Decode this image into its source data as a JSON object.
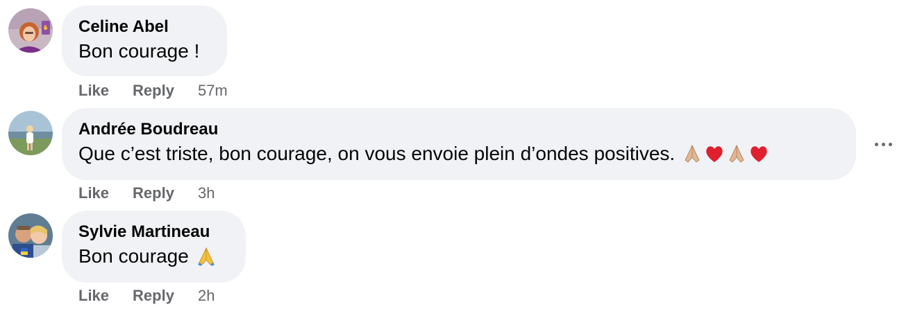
{
  "comments": [
    {
      "author": "Celine Abel",
      "text": "Bon courage !",
      "like_label": "Like",
      "reply_label": "Reply",
      "time": "57m",
      "avatar": "avatar-woman-red-hair"
    },
    {
      "author": "Andrée Boudreau",
      "text": "Que c’est triste, bon courage, on vous envoie plein d’ondes positives.",
      "emojis": [
        "folded-hands-icon",
        "red-heart-icon",
        "folded-hands-icon",
        "red-heart-icon"
      ],
      "like_label": "Like",
      "reply_label": "Reply",
      "time": "3h",
      "more_icon": "more-options-icon",
      "avatar": "avatar-woman-beach"
    },
    {
      "author": "Sylvie Martineau",
      "text": "Bon courage",
      "emojis": [
        "folded-hands-icon"
      ],
      "like_label": "Like",
      "reply_label": "Reply",
      "time": "2h",
      "avatar": "avatar-couple"
    }
  ],
  "colors": {
    "bubble_bg": "#f0f2f5",
    "text": "#050505",
    "meta": "#65676b",
    "heart": "#e0202e",
    "hands": "#e0b894"
  }
}
